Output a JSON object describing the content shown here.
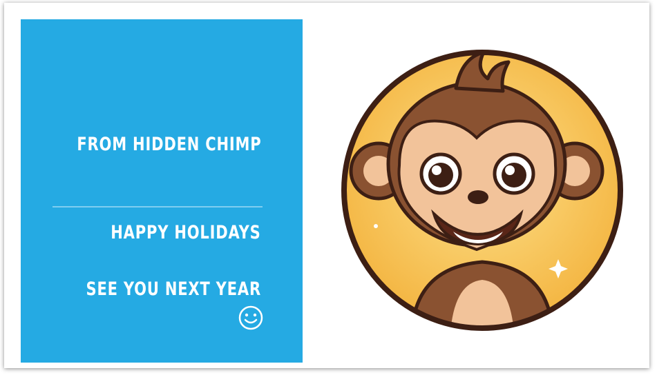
{
  "card": {
    "line1": "FROM HIDDEN CHIMP",
    "line2": "HAPPY HOLIDAYS",
    "line3": "SEE YOU NEXT YEAR",
    "emoji_icon": "smiley-face-icon"
  },
  "illustration": {
    "subject": "monkey-illustration"
  },
  "colors": {
    "panel": "#25aae3",
    "text": "#ffffff",
    "circle_fill": "#f8c65a",
    "circle_border": "#3d1f14",
    "fur": "#8a5231",
    "face": "#f2c39a"
  }
}
